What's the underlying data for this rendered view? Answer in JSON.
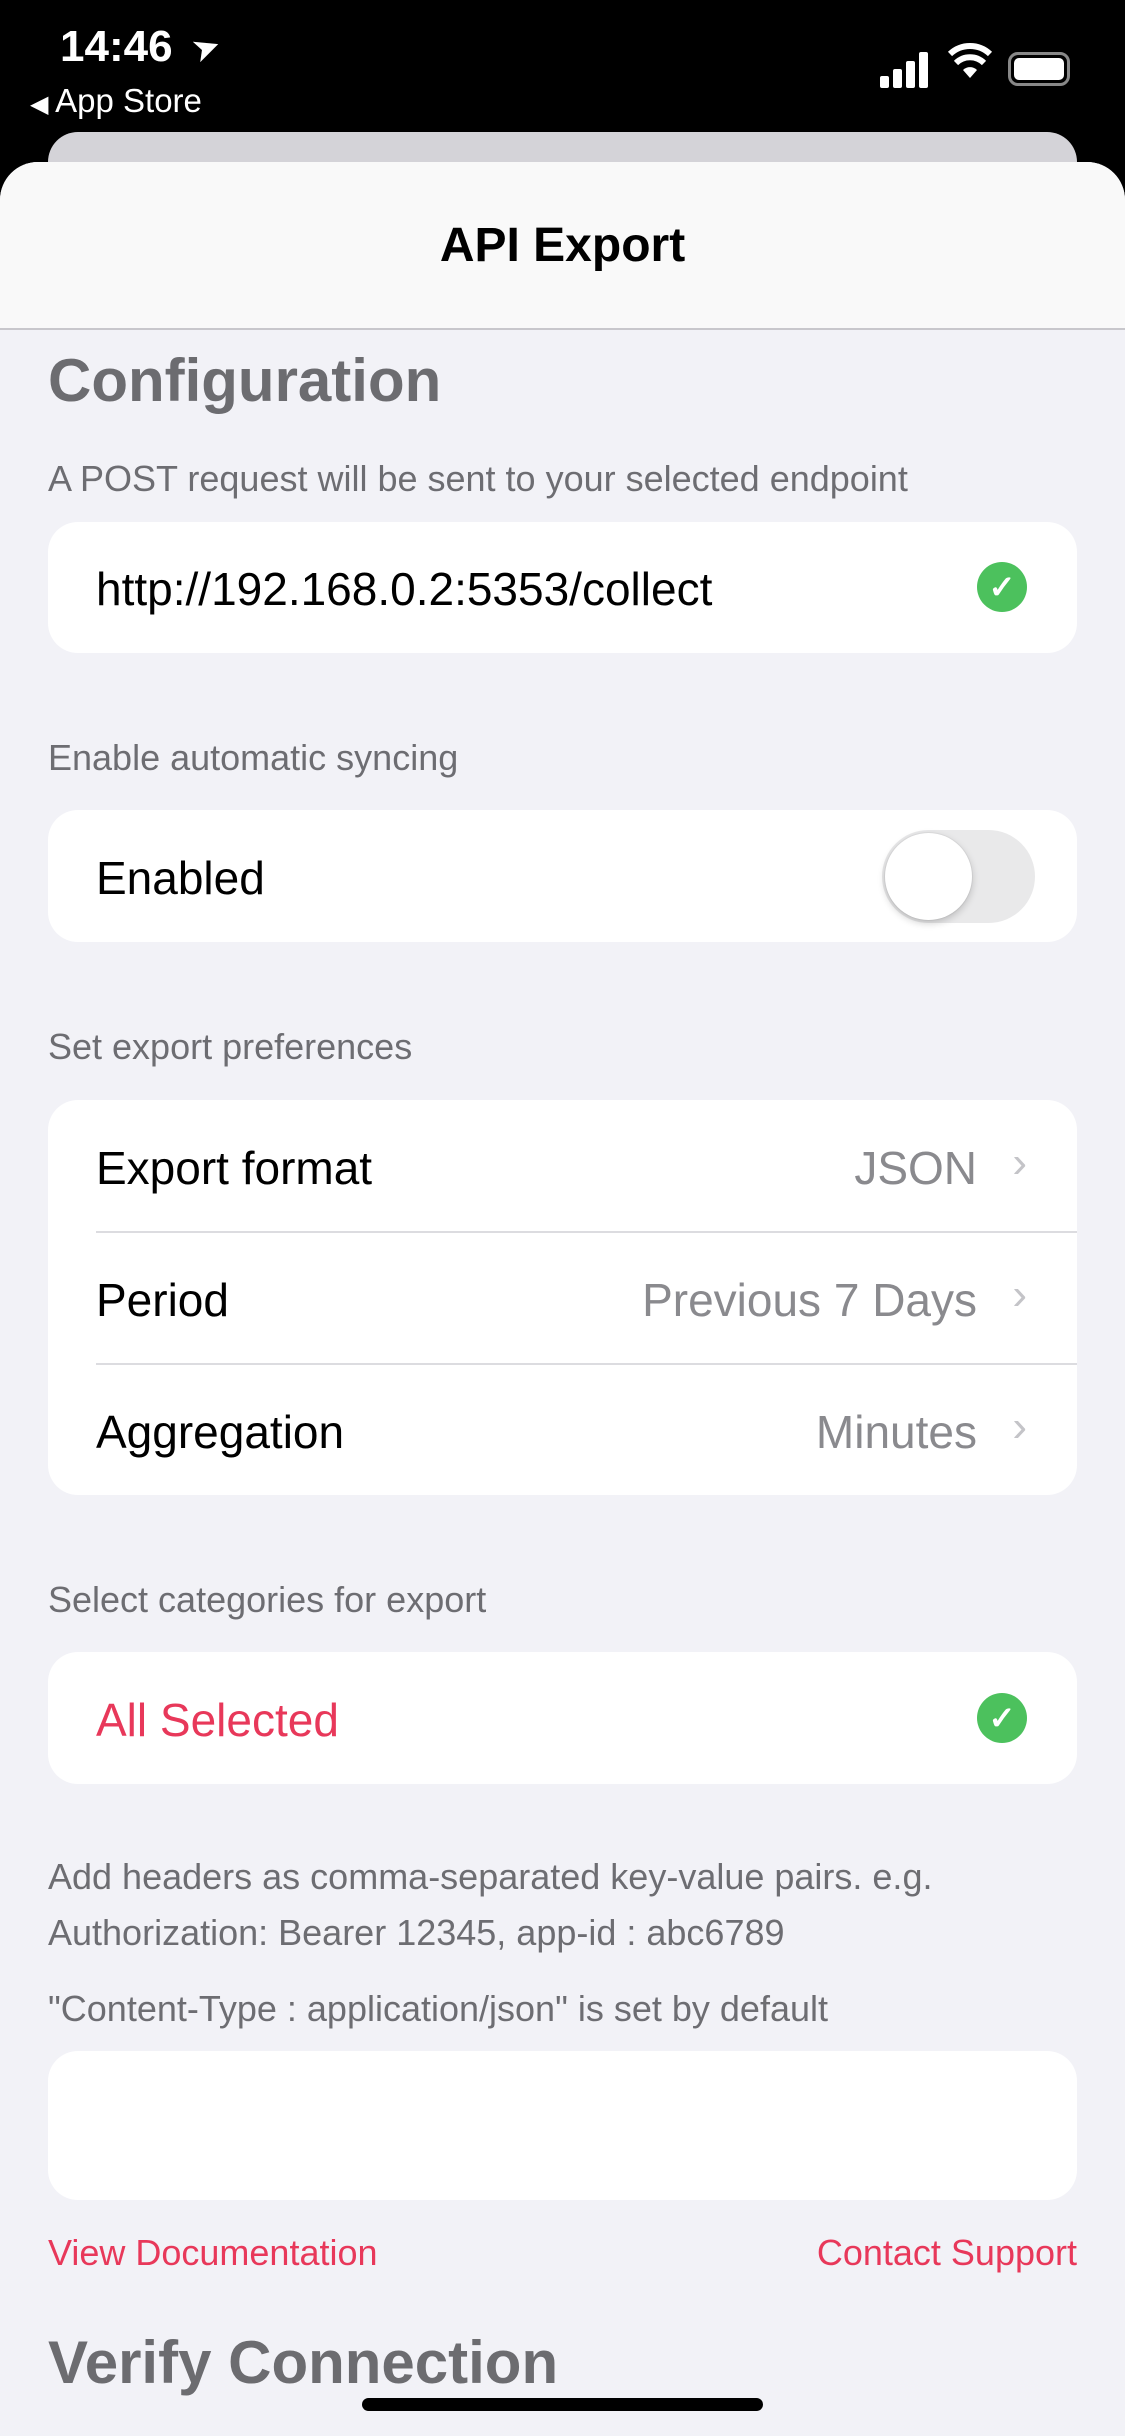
{
  "status_bar": {
    "time": "14:46",
    "back_label": "App Store"
  },
  "nav": {
    "title": "API Export"
  },
  "config": {
    "title": "Configuration",
    "subtitle": "A POST request will be sent to your selected endpoint",
    "endpoint": "http://192.168.0.2:5353/collect",
    "endpoint_valid": true
  },
  "sync": {
    "subtitle": "Enable automatic syncing",
    "label": "Enabled",
    "enabled": false
  },
  "prefs": {
    "subtitle": "Set export preferences",
    "rows": [
      {
        "label": "Export format",
        "value": "JSON"
      },
      {
        "label": "Period",
        "value": "Previous 7 Days"
      },
      {
        "label": "Aggregation",
        "value": "Minutes"
      }
    ]
  },
  "categories": {
    "subtitle": "Select categories for export",
    "value": "All Selected"
  },
  "headers": {
    "line1": "Add headers as comma-separated key-value pairs. e.g.",
    "line2": "Authorization: Bearer 12345, app-id : abc6789",
    "note": "\"Content-Type : application/json\" is set by default",
    "value": ""
  },
  "links": {
    "docs": "View Documentation",
    "support": "Contact Support"
  },
  "verify": {
    "title": "Verify Connection"
  },
  "colors": {
    "accent": "#e8385a",
    "success": "#4cc15d",
    "background": "#f2f2f7"
  }
}
